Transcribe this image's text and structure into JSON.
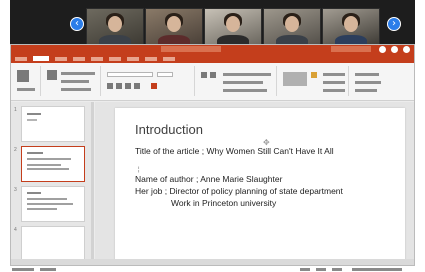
{
  "meeting": {
    "nav_prev": "‹",
    "nav_next": "›",
    "participants": [
      {
        "name": ""
      },
      {
        "name": ""
      },
      {
        "name": ""
      },
      {
        "name": ""
      },
      {
        "name": ""
      }
    ]
  },
  "app": {
    "accent": "#c43e1c"
  },
  "thumbnails": [
    {
      "number": "1",
      "selected": false
    },
    {
      "number": "2",
      "selected": true
    },
    {
      "number": "3",
      "selected": false
    },
    {
      "number": "4",
      "selected": false
    }
  ],
  "slide": {
    "title": "Introduction",
    "bullet_mark": "¦",
    "lines": [
      "Title of the article ; Why Women Still Can't Have It All",
      "Name of author ; Anne Marie Slaughter",
      "Her job ; Director of policy planning of state department",
      "Work in Princeton university"
    ]
  },
  "icons": {
    "move_handle": "✥"
  }
}
